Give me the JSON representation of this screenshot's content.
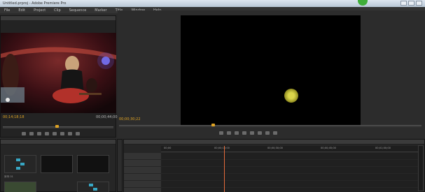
{
  "window": {
    "title": "Untitled.prproj - Adobe Premiere Pro"
  },
  "menu": [
    "File",
    "Edit",
    "Project",
    "Clip",
    "Sequence",
    "Marker",
    "Title",
    "Window",
    "Help"
  ],
  "source_monitor": {
    "timecode_current": "00;14;18;18",
    "timecode_duration": "00;00;44;00"
  },
  "program_monitor": {
    "timecode_current": "00;00;30;22"
  },
  "timeline": {
    "ruler_labels": [
      "00;00",
      "00;00;15;00",
      "00;00;30;00",
      "00;00;45;00",
      "00;01;00;00"
    ]
  },
  "project": {
    "thumbs": [
      "序列 01",
      "",
      "",
      ""
    ]
  },
  "colors": {
    "timecode": "#e0a424",
    "playhead": "#e56b3a",
    "cursor": "#dad54a"
  }
}
